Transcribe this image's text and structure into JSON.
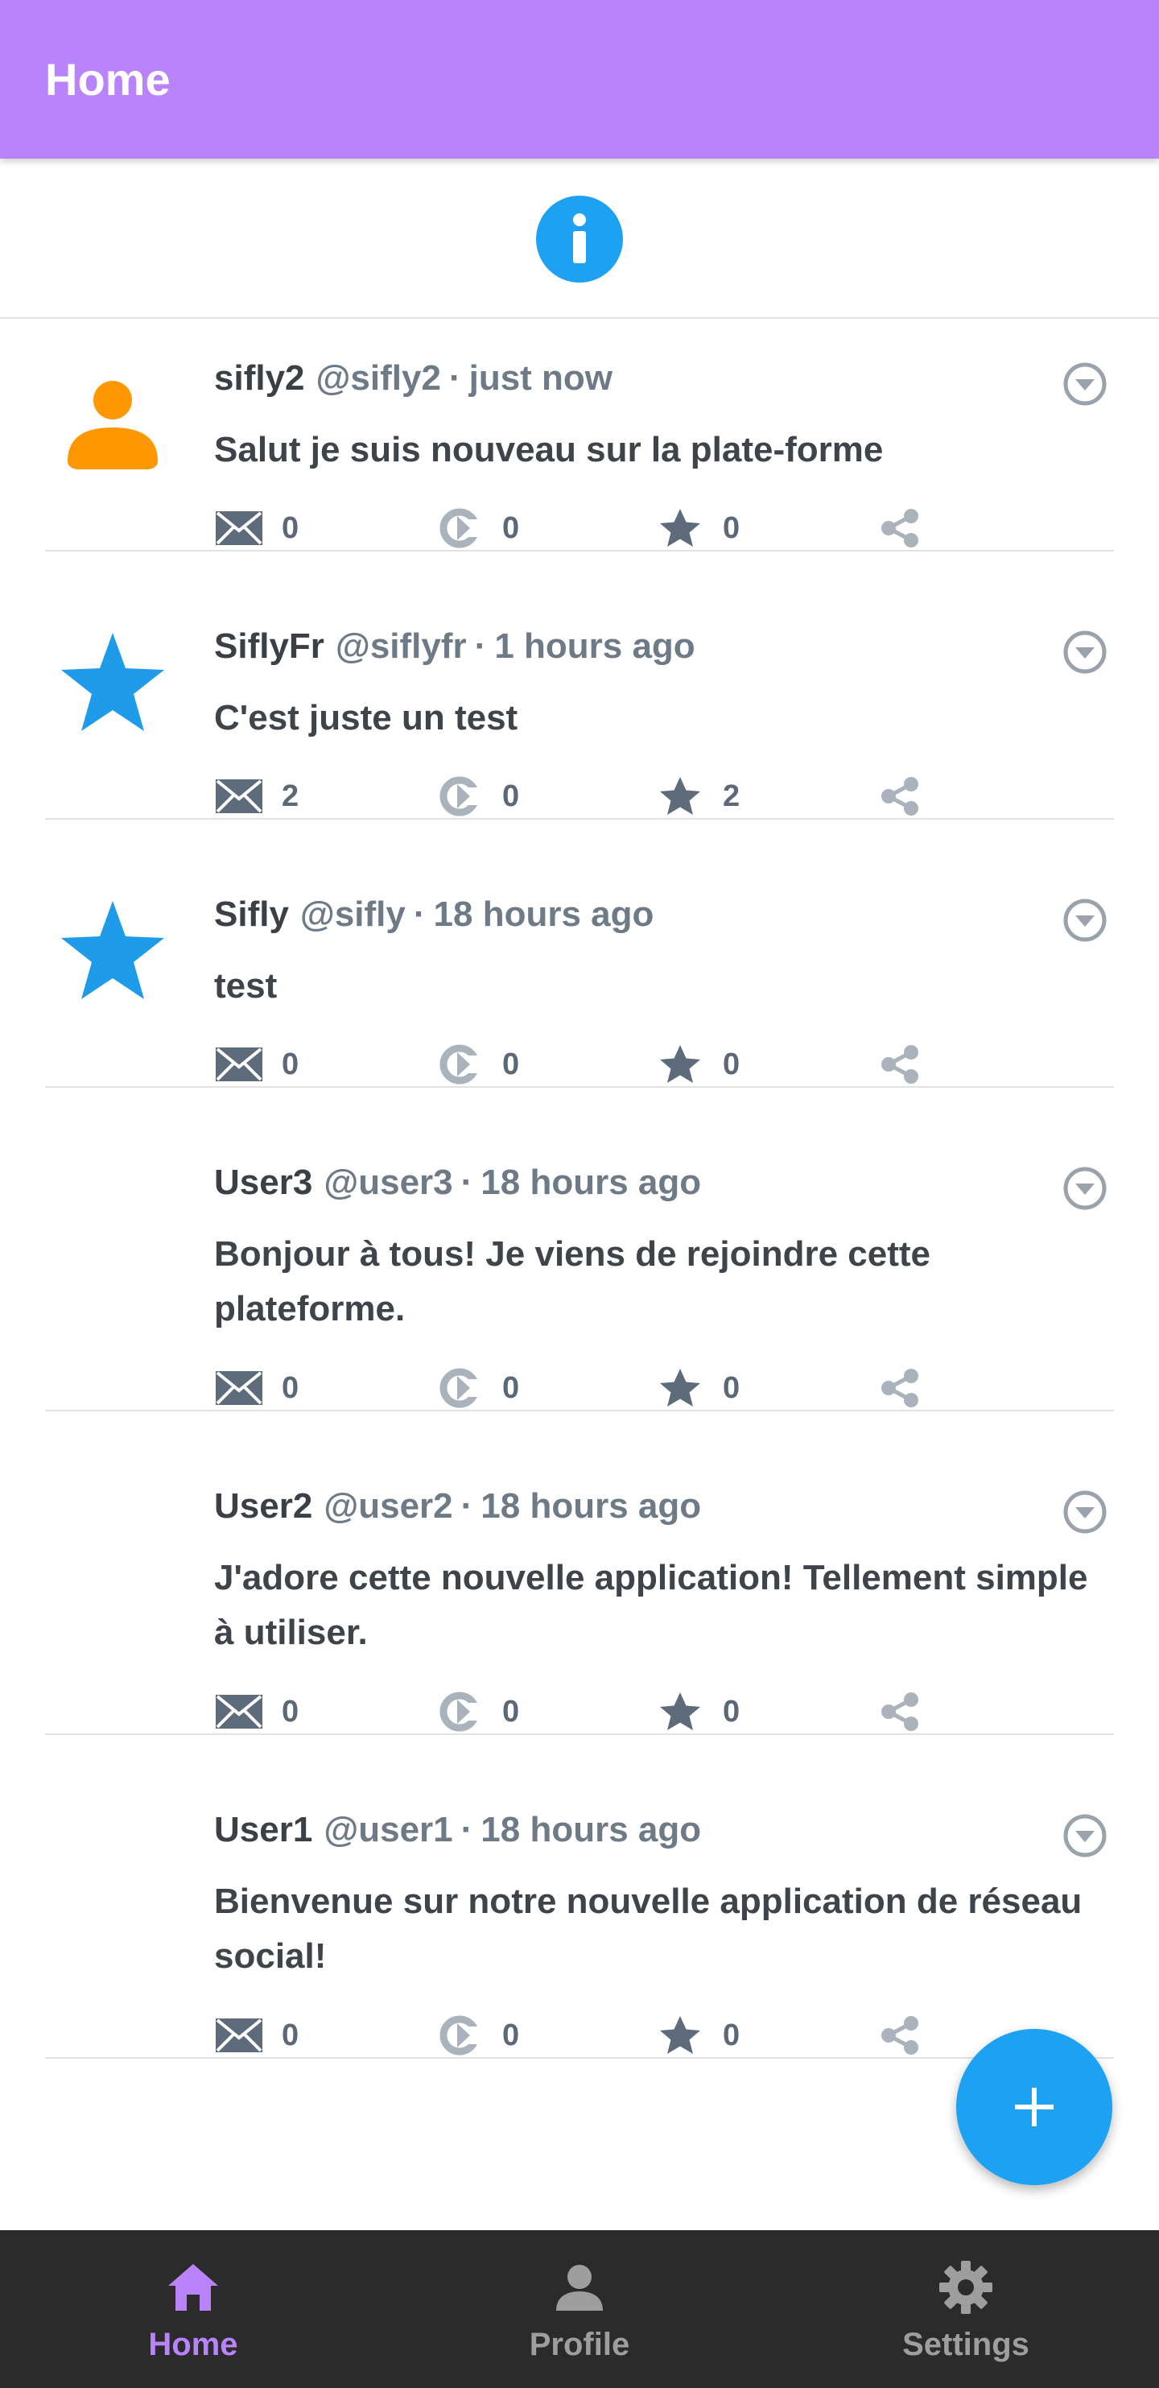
{
  "app": {
    "title": "Home"
  },
  "colors": {
    "appbar": "#b983fb",
    "accent": "#1da1f2",
    "nav_active": "#b983fb",
    "nav_inactive": "#9e9e9e"
  },
  "posts": [
    {
      "name": "sifly2",
      "handle": "@sifly2",
      "time": "just now",
      "text": "Salut je suis nouveau sur la plate-forme",
      "avatar": "person-icon",
      "replies": "0",
      "reposts": "0",
      "likes": "0"
    },
    {
      "name": "SiflyFr",
      "handle": "@siflyfr",
      "time": "1 hours ago",
      "text": "C'est juste un test",
      "avatar": "star-icon",
      "replies": "2",
      "reposts": "0",
      "likes": "2"
    },
    {
      "name": "Sifly",
      "handle": "@sifly",
      "time": "18 hours ago",
      "text": "test",
      "avatar": "star-icon",
      "replies": "0",
      "reposts": "0",
      "likes": "0"
    },
    {
      "name": "User3",
      "handle": "@user3",
      "time": "18 hours ago",
      "text": "Bonjour à tous! Je viens de rejoindre cette plateforme.",
      "avatar": "",
      "replies": "0",
      "reposts": "0",
      "likes": "0"
    },
    {
      "name": "User2",
      "handle": "@user2",
      "time": "18 hours ago",
      "text": "J'adore cette nouvelle application! Tellement simple à utiliser.",
      "avatar": "",
      "replies": "0",
      "reposts": "0",
      "likes": "0"
    },
    {
      "name": "User1",
      "handle": "@user1",
      "time": "18 hours ago",
      "text": "Bienvenue sur notre nouvelle application de réseau social!",
      "avatar": "",
      "replies": "0",
      "reposts": "0",
      "likes": "0"
    }
  ],
  "separator": "·",
  "nav": [
    {
      "label": "Home",
      "icon": "home-icon",
      "active": true
    },
    {
      "label": "Profile",
      "icon": "person-icon",
      "active": false
    },
    {
      "label": "Settings",
      "icon": "gear-icon",
      "active": false
    }
  ]
}
